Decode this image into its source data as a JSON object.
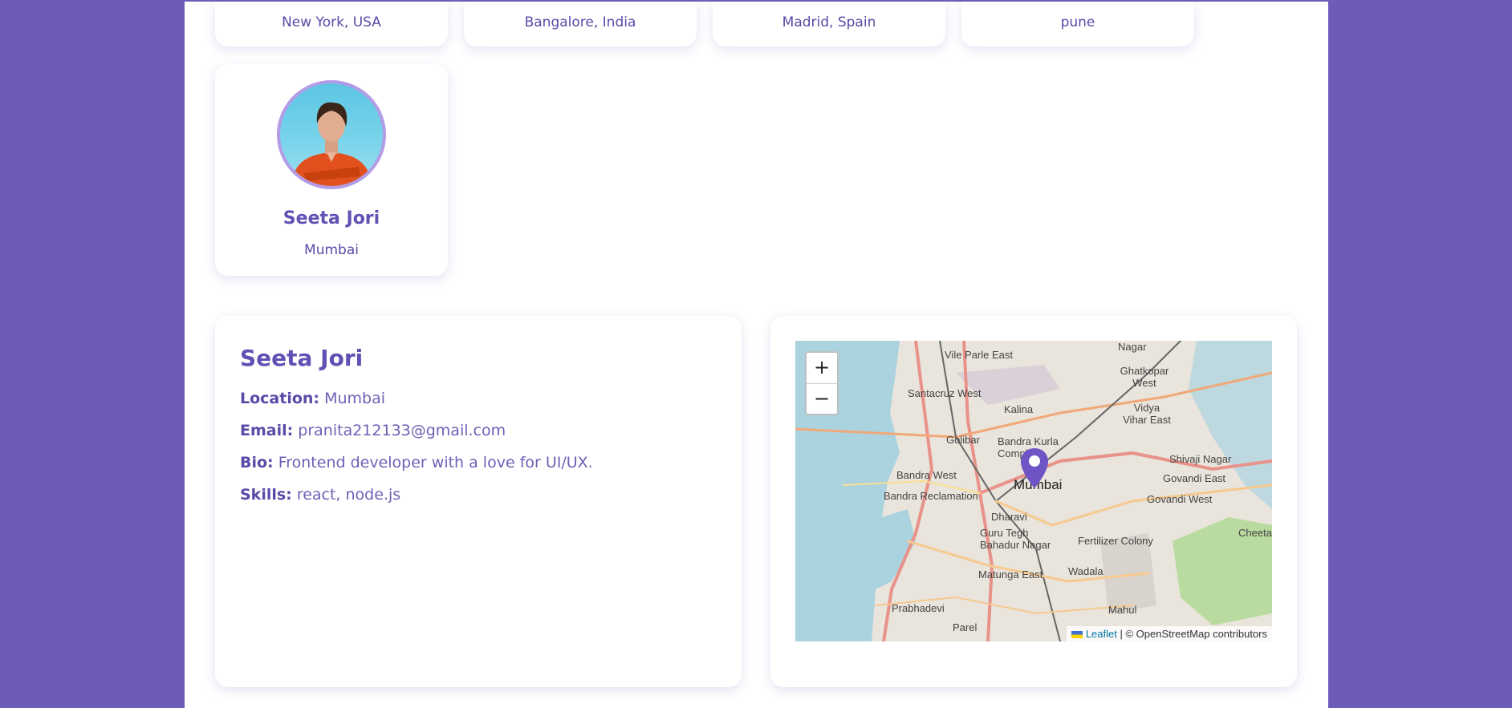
{
  "top_cards": [
    {
      "location": "New York, USA"
    },
    {
      "location": "Bangalore, India"
    },
    {
      "location": "Madrid, Spain"
    },
    {
      "location": "pune"
    }
  ],
  "profile_card": {
    "name": "Seeta Jori",
    "location": "Mumbai"
  },
  "details": {
    "name": "Seeta Jori",
    "location_label": "Location:",
    "location": "Mumbai",
    "email_label": "Email:",
    "email": "pranita212133@gmail.com",
    "bio_label": "Bio:",
    "bio": "Frontend developer with a love for UI/UX.",
    "skills_label": "Skills:",
    "skills": "react, node.js"
  },
  "map": {
    "zoom_in": "+",
    "zoom_out": "−",
    "attribution_link": "Leaflet",
    "attribution_text": "| © OpenStreetMap contributors",
    "labels": [
      "Vile Parle East",
      "Nagar",
      "Ghatkopar West",
      "Santacruz West",
      "Kalina",
      "Vidya Vihar East",
      "Golibar",
      "Bandra Kurla Complex",
      "Shivaji Nagar",
      "Bandra West",
      "Govandi East",
      "Mumbai",
      "Bandra Reclamation",
      "Govandi West",
      "Dharavi",
      "Guru Tegh Bahadur Nagar",
      "Fertilizer Colony",
      "Cheeta",
      "Matunga East",
      "Wadala",
      "Prabhadevi",
      "Mahul",
      "Parel"
    ]
  },
  "colors": {
    "background": "#6e5bb8",
    "accent": "#6350b4",
    "marker": "#6e54c4"
  }
}
